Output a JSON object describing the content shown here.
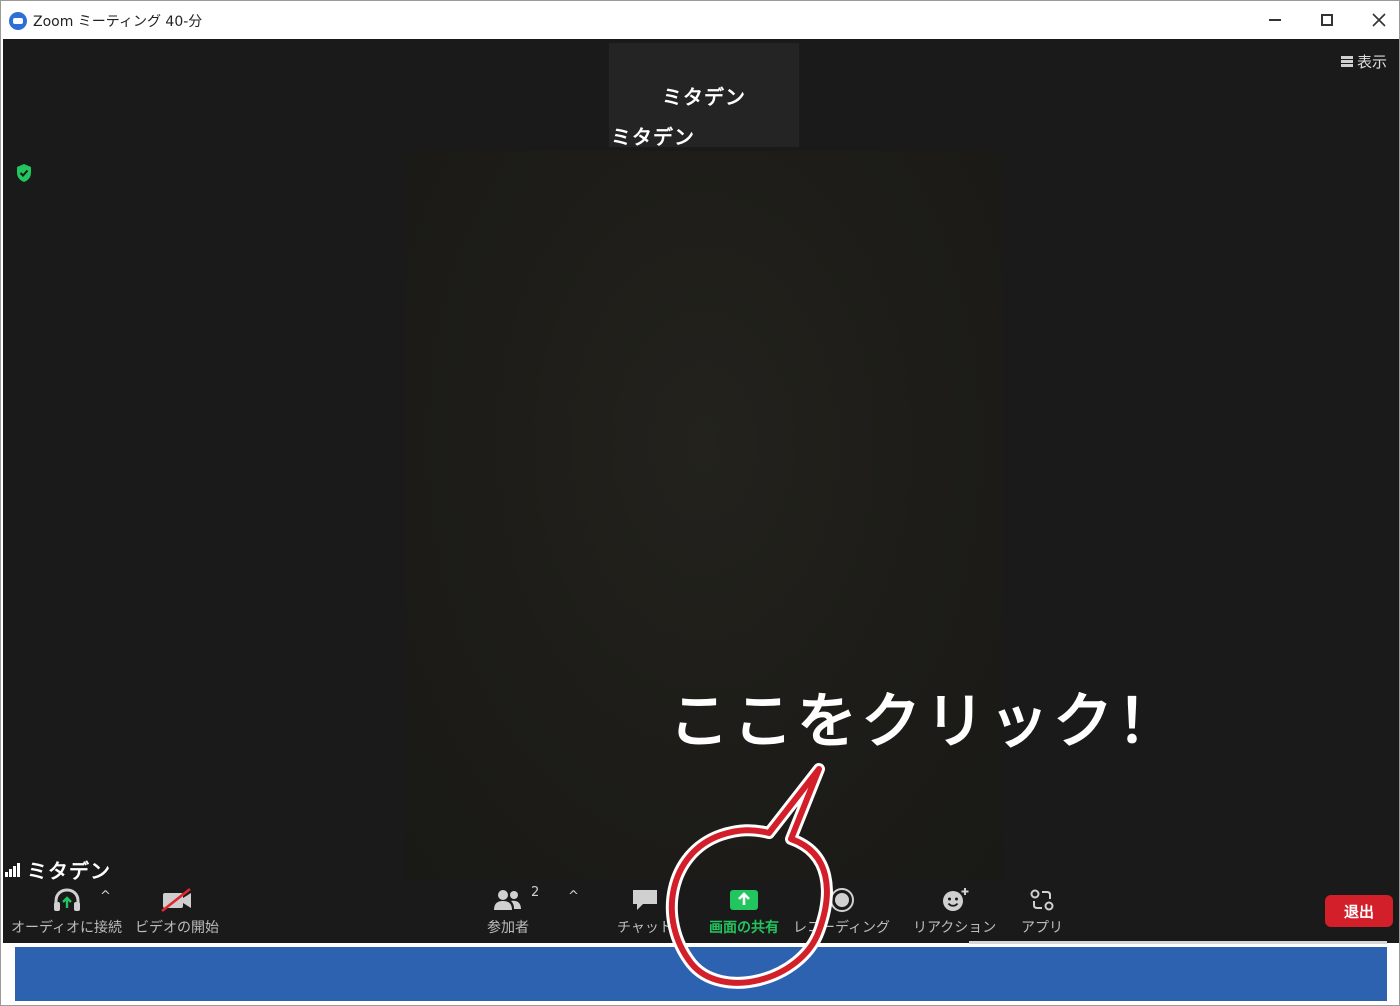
{
  "window": {
    "title": "Zoom ミーティング 40-分",
    "minimize_label": "−",
    "maximize_label": "□",
    "close_label": "✕"
  },
  "meeting": {
    "view_label": "表示",
    "thumbnail_name": "ミタデン",
    "main_name": "ミタデン",
    "speaker_name": "ミタデン",
    "participant_count": "2",
    "encryption_icon": "shield-check-icon",
    "accent_color": "#22c55e"
  },
  "toolbar": {
    "audio_label": "オーディオに接続",
    "video_label": "ビデオの開始",
    "participants_label": "参加者",
    "chat_label": "チャット",
    "share_label": "画面の共有",
    "record_label": "レコーディング",
    "reactions_label": "リアクション",
    "apps_label": "アプリ",
    "leave_label": "退出",
    "caret": "^"
  },
  "annotation": {
    "text": "ここをクリック！",
    "color": "#d21f2a"
  }
}
